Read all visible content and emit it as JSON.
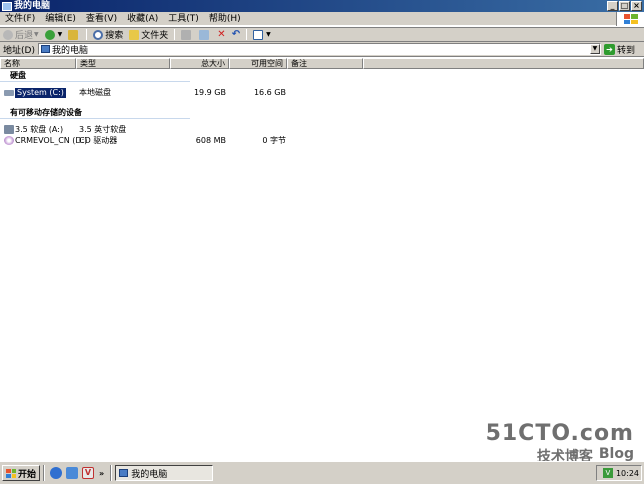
{
  "window": {
    "title": "我的电脑",
    "buttons": {
      "minimize": "_",
      "maximize": "□",
      "close": "×"
    }
  },
  "menu": [
    "文件(F)",
    "编辑(E)",
    "查看(V)",
    "收藏(A)",
    "工具(T)",
    "帮助(H)"
  ],
  "toolbar": {
    "back_label": "后退",
    "search_label": "搜索",
    "folders_label": "文件夹"
  },
  "address": {
    "label": "地址(D)",
    "value": "我的电脑",
    "go_label": "转到"
  },
  "columns": [
    "名称",
    "类型",
    "总大小",
    "可用空间",
    "备注"
  ],
  "groups": [
    {
      "title": "硬盘",
      "items": [
        {
          "name": "System (C:)",
          "type": "本地磁盘",
          "total": "19.9 GB",
          "free": "16.6 GB",
          "selected": true
        }
      ]
    },
    {
      "title": "有可移动存储的设备",
      "items": [
        {
          "name": "3.5 软盘 (A:)",
          "type": "3.5 英寸软盘",
          "total": "",
          "free": ""
        },
        {
          "name": "CRMEVOL_CN (D:)",
          "type": "CD 驱动器",
          "total": "608 MB",
          "free": "0 字节"
        }
      ]
    }
  ],
  "watermark": {
    "line1": "51CTO.com",
    "line2a": "技术博客",
    "line2b": "Blog"
  },
  "taskbar": {
    "start_label": "开始",
    "more": "»",
    "task_label": "我的电脑",
    "clock": "10:24",
    "tray_icon": "V"
  },
  "colors": {
    "title_start": "#0a246a",
    "title_end": "#3a6ea5",
    "face": "#d4d0c8",
    "selection": "#0a246a"
  }
}
